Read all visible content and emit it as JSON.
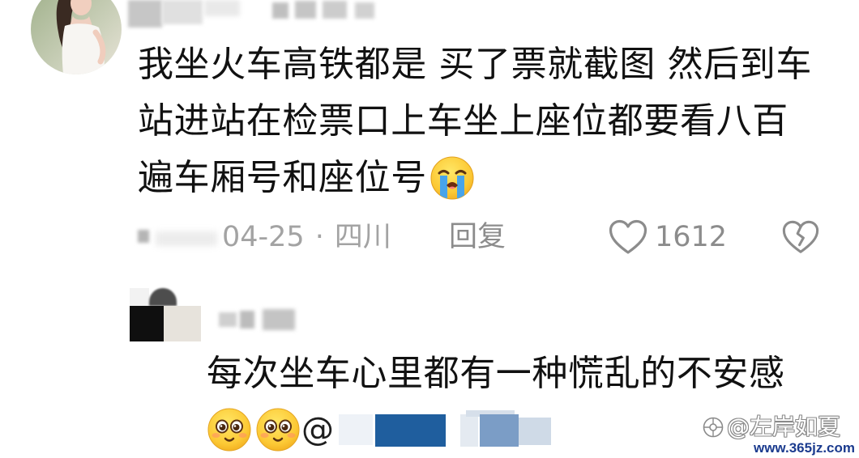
{
  "comments": [
    {
      "text_lines": [
        "我坐火车高铁都是 买了票就截图 然后到车",
        "站进站在检票口上车坐上座位都要看八百",
        "遍车厢号和座位号"
      ],
      "trailing_emoji": "loudly-crying-face-icon",
      "meta": {
        "date": "04-25",
        "separator": "·",
        "location": "四川",
        "reply_label": "回复",
        "like_count": 1612,
        "like_icon": "heart-outline-icon",
        "dislike_icon": "broken-heart-icon"
      }
    },
    {
      "text_lines": [
        "每次坐车心里都有一种慌乱的不安感"
      ],
      "emojis": [
        "smiling-face-icon",
        "smiling-face-icon"
      ],
      "mention_prefix": "@"
    }
  ],
  "watermark": {
    "logo_icon": "watermark-logo-icon",
    "handle": "@左岸如夏",
    "site": "www.365jz.com"
  },
  "colors": {
    "comment_text": "#111111",
    "meta_text": "#a3a3a3",
    "action_text": "#8c8c8c",
    "watermark_site": "#1b3b8e"
  }
}
